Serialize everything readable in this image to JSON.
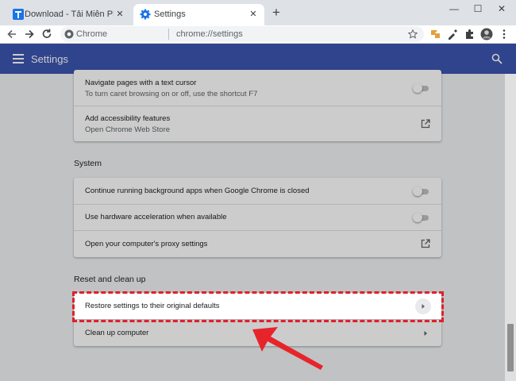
{
  "browser": {
    "tabs": [
      {
        "title": "Download - Tải Miễn Phí VN - Ph",
        "icon": "t-logo-icon"
      },
      {
        "title": "Settings",
        "icon": "gear-icon"
      }
    ],
    "omnibox": {
      "site_label": "Chrome",
      "url": "chrome://settings"
    }
  },
  "header": {
    "title": "Settings"
  },
  "accessibility": {
    "items": [
      {
        "title": "Navigate pages with a text cursor",
        "subtitle": "To turn caret browsing on or off, use the shortcut F7",
        "control": "toggle",
        "on": false
      },
      {
        "title": "Add accessibility features",
        "subtitle": "Open Chrome Web Store",
        "control": "external-link-icon"
      }
    ]
  },
  "system": {
    "title": "System",
    "items": [
      {
        "title": "Continue running background apps when Google Chrome is closed",
        "control": "toggle",
        "on": false
      },
      {
        "title": "Use hardware acceleration when available",
        "control": "toggle",
        "on": false
      },
      {
        "title": "Open your computer's proxy settings",
        "control": "external-link-icon"
      }
    ]
  },
  "reset": {
    "title": "Reset and clean up",
    "items": [
      {
        "title": "Restore settings to their original defaults",
        "control": "chevron-right-icon",
        "highlighted": true
      },
      {
        "title": "Clean up computer",
        "control": "chevron-right-icon"
      }
    ]
  },
  "colors": {
    "header_blue": "#3b56b0",
    "highlight_red": "#e0202a",
    "arrow_red": "#e8242b"
  }
}
